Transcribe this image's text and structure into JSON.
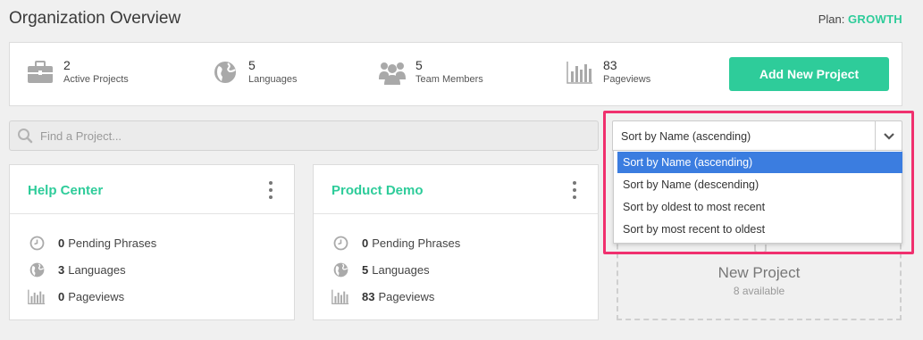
{
  "header": {
    "title": "Organization Overview",
    "plan_label": "Plan:",
    "plan_value": "GROWTH"
  },
  "stats": [
    {
      "value": "2",
      "label": "Active Projects",
      "icon": "briefcase-icon"
    },
    {
      "value": "5",
      "label": "Languages",
      "icon": "globe-icon"
    },
    {
      "value": "5",
      "label": "Team Members",
      "icon": "team-icon"
    },
    {
      "value": "83",
      "label": "Pageviews",
      "icon": "bar-chart-icon"
    }
  ],
  "add_button_label": "Add New Project",
  "search": {
    "placeholder": "Find a Project..."
  },
  "sort": {
    "selected": "Sort by Name (ascending)",
    "options": [
      "Sort by Name (ascending)",
      "Sort by Name (descending)",
      "Sort by oldest to most recent",
      "Sort by most recent to oldest"
    ]
  },
  "projects": [
    {
      "name": "Help Center",
      "pending_count": "0",
      "pending_label": "Pending Phrases",
      "languages_count": "3",
      "languages_label": "Languages",
      "pageviews_count": "0",
      "pageviews_label": "Pageviews"
    },
    {
      "name": "Product Demo",
      "pending_count": "0",
      "pending_label": "Pending Phrases",
      "languages_count": "5",
      "languages_label": "Languages",
      "pageviews_count": "83",
      "pageviews_label": "Pageviews"
    }
  ],
  "new_project": {
    "title": "New Project",
    "subtitle": "8 available"
  },
  "colors": {
    "accent": "#2ecc9a",
    "highlight": "#f0306e",
    "selected_option": "#3b7de0"
  }
}
